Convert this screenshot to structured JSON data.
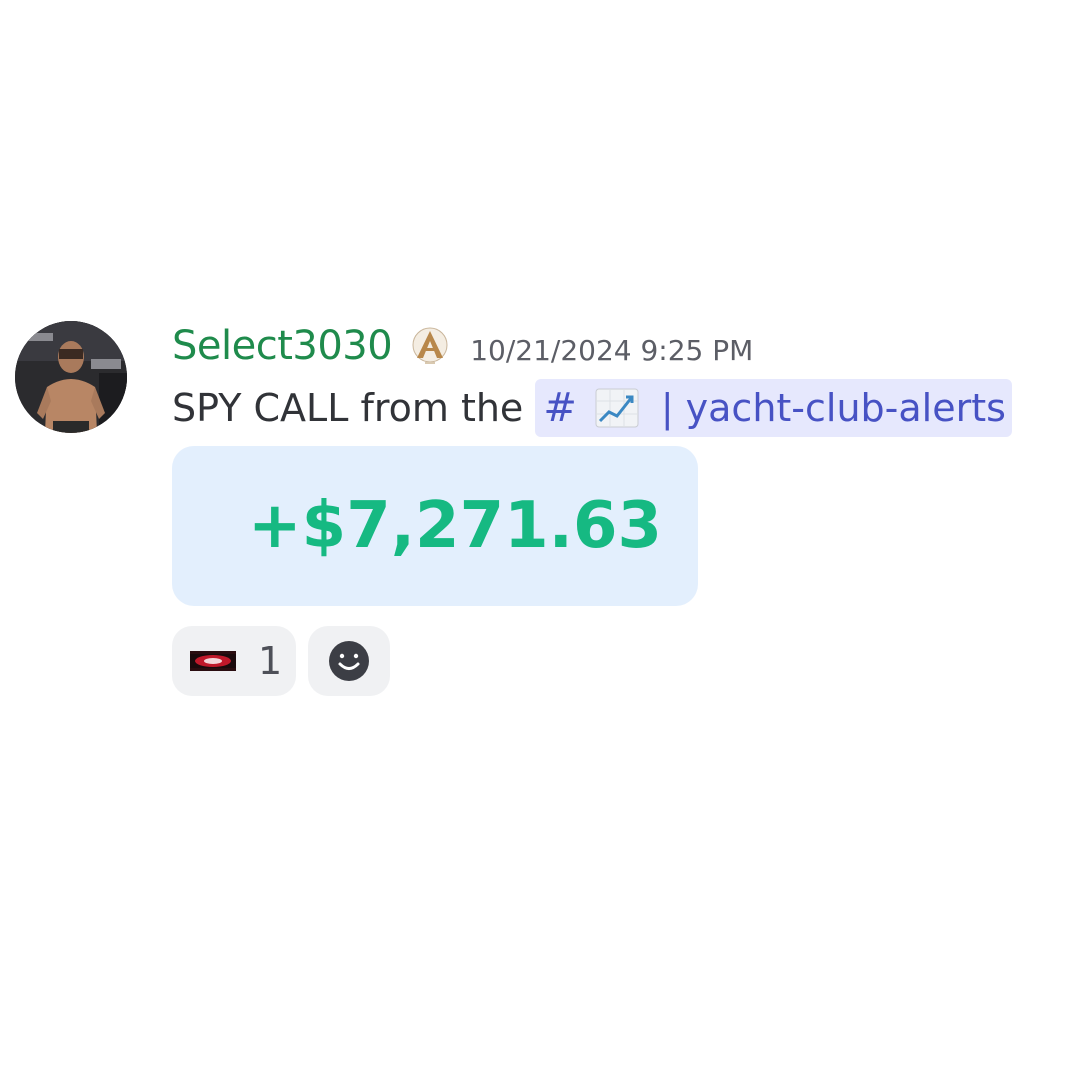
{
  "message": {
    "author": "Select3030",
    "timestamp": "10/21/2024 9:25 PM",
    "text": "SPY CALL from the",
    "channel_mention": {
      "prefix": "#",
      "emoji": "chart-increasing-icon",
      "separator": "|",
      "name": "yacht-club-alerts"
    },
    "pnl": "+$7,271.63"
  },
  "reactions": [
    {
      "emoji": "custom-red-emoji-icon",
      "count": "1"
    }
  ],
  "colors": {
    "username": "#1f8b4c",
    "mention_bg": "#e6e8fd",
    "mention_text": "#4752c4",
    "pnl_bg": "#e3effd",
    "pnl_text": "#16b982"
  }
}
